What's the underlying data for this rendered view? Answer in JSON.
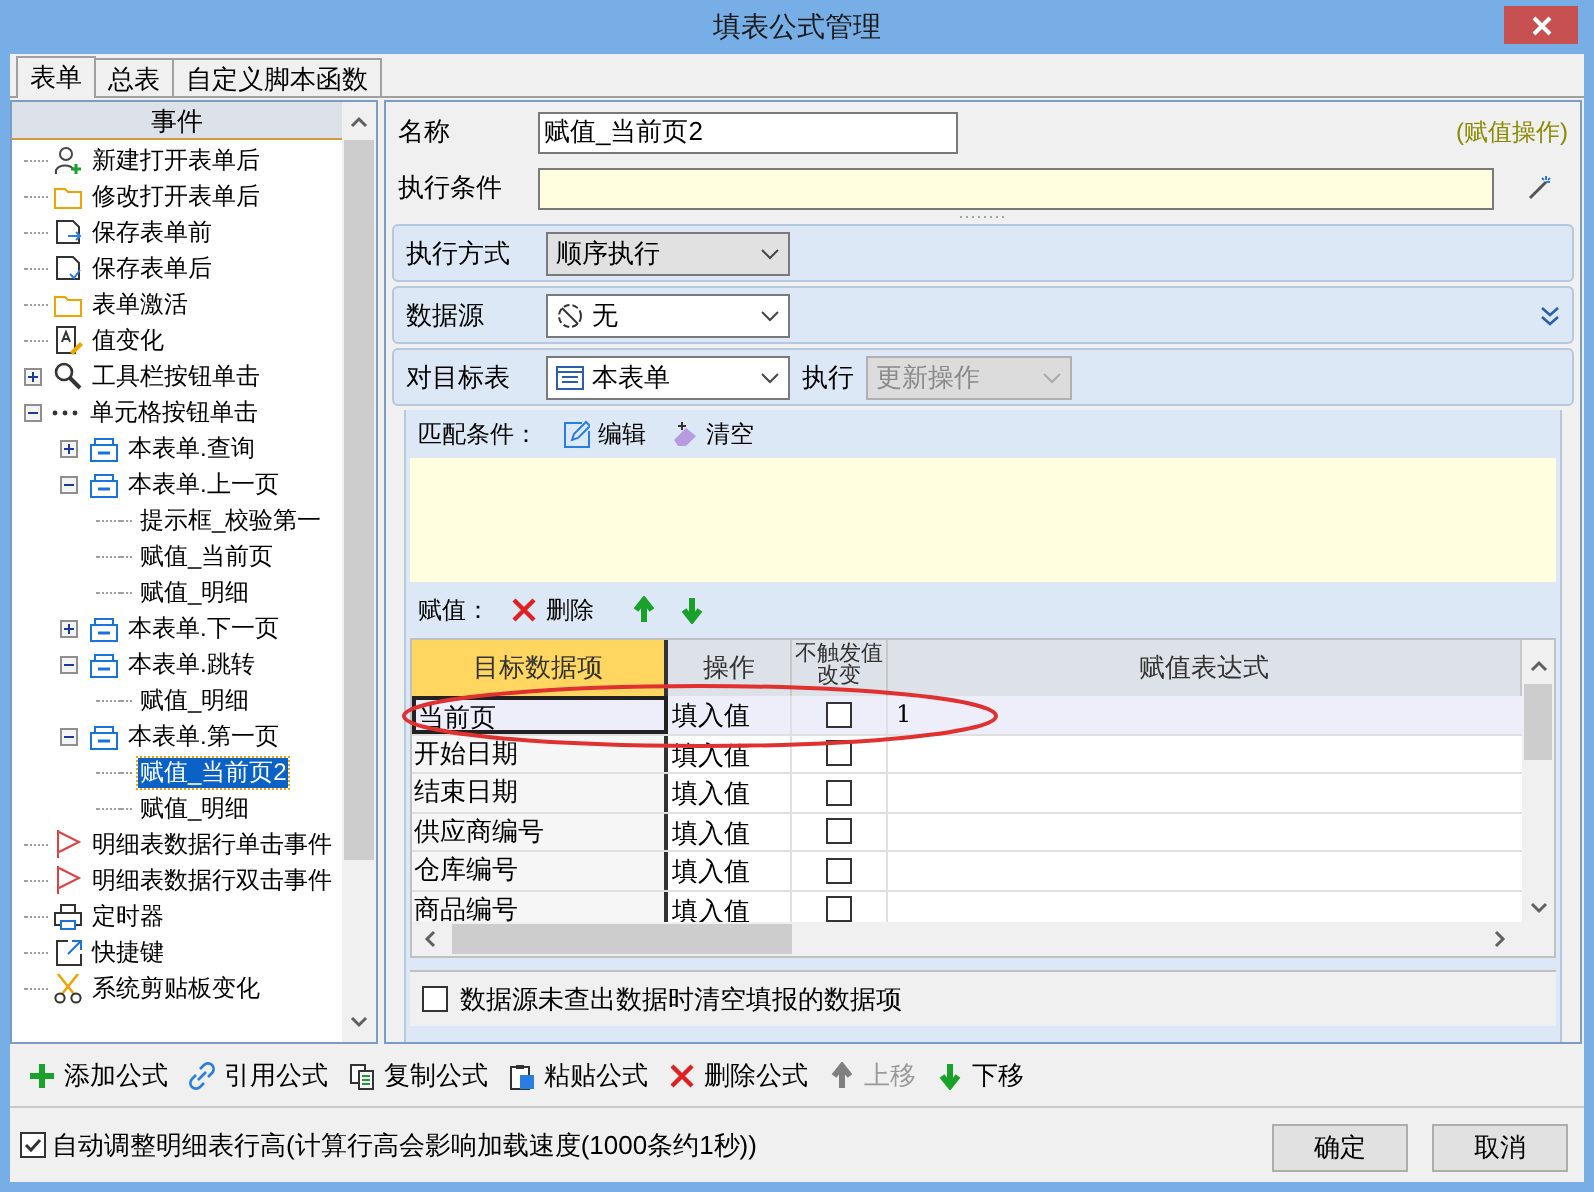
{
  "window": {
    "title": "填表公式管理"
  },
  "tabs": [
    {
      "label": "表单",
      "selected": true
    },
    {
      "label": "总表",
      "selected": false
    },
    {
      "label": "自定义脚本函数",
      "selected": false
    }
  ],
  "events": {
    "header": "事件",
    "items": [
      {
        "label": "新建打开表单后",
        "kind": "useradd",
        "selected": false
      },
      {
        "label": "修改打开表单后",
        "kind": "folder",
        "selected": false
      },
      {
        "label": "保存表单前",
        "kind": "savein",
        "selected": false
      },
      {
        "label": "保存表单后",
        "kind": "savecheck",
        "selected": false
      },
      {
        "label": "表单激活",
        "kind": "folder",
        "selected": false
      },
      {
        "label": "值变化",
        "kind": "docedit",
        "selected": false
      },
      {
        "label": "工具栏按钮单击",
        "kind": "toolsearch",
        "selected": false,
        "expanded": false
      },
      {
        "label": "单元格按钮单击",
        "kind": "dots",
        "selected": false,
        "expanded": true,
        "children": [
          {
            "label": "本表单.查询",
            "kind": "form",
            "selected": false,
            "expanded": false
          },
          {
            "label": "本表单.上一页",
            "kind": "form",
            "selected": false,
            "expanded": true,
            "children": [
              {
                "label": "提示框_校验第一",
                "selected": false
              },
              {
                "label": "赋值_当前页",
                "selected": false
              },
              {
                "label": "赋值_明细",
                "selected": false
              }
            ]
          },
          {
            "label": "本表单.下一页",
            "kind": "form",
            "selected": false,
            "expanded": false
          },
          {
            "label": "本表单.跳转",
            "kind": "form",
            "selected": false,
            "expanded": true,
            "children": [
              {
                "label": "赋值_明细",
                "selected": false
              }
            ]
          },
          {
            "label": "本表单.第一页",
            "kind": "form",
            "selected": false,
            "expanded": true,
            "children": [
              {
                "label": "赋值_当前页2",
                "selected": true
              },
              {
                "label": "赋值_明细",
                "selected": false
              }
            ]
          }
        ]
      },
      {
        "label": "明细表数据行单击事件",
        "kind": "flag",
        "selected": false
      },
      {
        "label": "明细表数据行双击事件",
        "kind": "flag",
        "selected": false
      },
      {
        "label": "定时器",
        "kind": "printer",
        "selected": false
      },
      {
        "label": "快捷键",
        "kind": "shortcut",
        "selected": false
      },
      {
        "label": "系统剪贴板变化",
        "kind": "scissors",
        "selected": false
      }
    ]
  },
  "form": {
    "name_label": "名称",
    "name_value": "赋值_当前页2",
    "type_note": "(赋值操作)",
    "condition_label": "执行条件"
  },
  "exec_mode": {
    "label": "执行方式",
    "value": "顺序执行"
  },
  "data_source": {
    "label": "数据源",
    "value": "无"
  },
  "target": {
    "label": "对目标表",
    "value": "本表单",
    "exec_label": "执行",
    "exec_value": "更新操作",
    "exec_disabled": true
  },
  "match": {
    "label": "匹配条件：",
    "buttons": [
      {
        "kind": "edit",
        "label": "编辑"
      },
      {
        "kind": "clear",
        "label": "清空"
      }
    ]
  },
  "assign": {
    "label": "赋值：",
    "buttons": [
      {
        "kind": "delete",
        "label": "删除"
      },
      {
        "kind": "up"
      },
      {
        "kind": "down"
      }
    ]
  },
  "table": {
    "columns": [
      "目标数据项",
      "操作",
      "不触发值改变",
      "赋值表达式"
    ],
    "rows": [
      {
        "target": "当前页",
        "op": "填入值",
        "no_trigger": false,
        "expr": "1",
        "selected": true
      },
      {
        "target": "开始日期",
        "op": "填入值",
        "no_trigger": false,
        "selected": false
      },
      {
        "target": "结束日期",
        "op": "填入值",
        "no_trigger": false,
        "selected": false
      },
      {
        "target": "供应商编号",
        "op": "填入值",
        "no_trigger": false,
        "selected": false
      },
      {
        "target": "仓库编号",
        "op": "填入值",
        "no_trigger": false,
        "selected": false
      },
      {
        "target": "商品编号",
        "op": "填入值",
        "no_trigger": false,
        "selected": false
      }
    ]
  },
  "clear_option": {
    "label": "数据源未查出数据时清空填报的数据项",
    "checked": false
  },
  "toolbar": [
    {
      "kind": "add",
      "label": "添加公式",
      "disabled": false
    },
    {
      "kind": "link",
      "label": "引用公式",
      "disabled": false
    },
    {
      "kind": "copy",
      "label": "复制公式",
      "disabled": false
    },
    {
      "kind": "paste",
      "label": "粘贴公式",
      "disabled": false
    },
    {
      "kind": "delete",
      "label": "删除公式",
      "disabled": false
    },
    {
      "kind": "up",
      "label": "上移",
      "disabled": true
    },
    {
      "kind": "down",
      "label": "下移",
      "disabled": false
    }
  ],
  "auto_height": {
    "label": "自动调整明细表行高(计算行高会影响加载速度(1000条约1秒))",
    "checked": true
  },
  "buttons": [
    "确定",
    "取消"
  ]
}
